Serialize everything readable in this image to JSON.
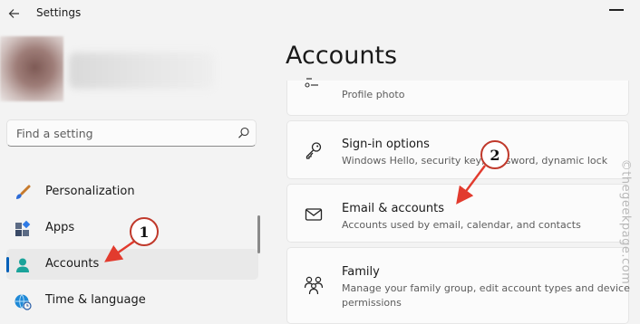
{
  "window": {
    "title": "Settings"
  },
  "search": {
    "placeholder": "Find a setting"
  },
  "sidebar": {
    "items": [
      {
        "label": "Personalization",
        "icon": "brush-icon"
      },
      {
        "label": "Apps",
        "icon": "apps-icon"
      },
      {
        "label": "Accounts",
        "icon": "person-icon",
        "selected": true
      },
      {
        "label": "Time & language",
        "icon": "globe-clock-icon"
      }
    ]
  },
  "main": {
    "title": "Accounts",
    "cards": [
      {
        "title": "",
        "desc": "Profile photo",
        "icon": "profile-photo-icon"
      },
      {
        "title": "Sign-in options",
        "desc": "Windows Hello, security key, password, dynamic lock",
        "icon": "key-icon"
      },
      {
        "title": "Email & accounts",
        "desc": "Accounts used by email, calendar, and contacts",
        "icon": "mail-icon"
      },
      {
        "title": "Family",
        "desc": "Manage your family group, edit account types and device",
        "desc2": "permissions",
        "icon": "family-icon"
      }
    ]
  },
  "annotations": [
    "1",
    "2"
  ],
  "watermark": "©thegeekpage.com",
  "colors": {
    "accent": "#005fb8",
    "annotation": "#c0392b",
    "background": "#f3f3f3",
    "card": "#fbfbfb"
  }
}
